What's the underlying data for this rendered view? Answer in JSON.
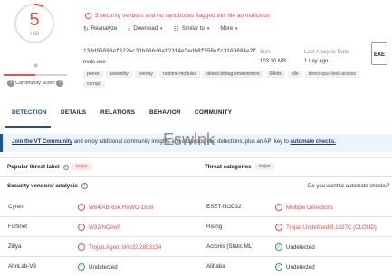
{
  "score": {
    "detections": "5",
    "total": "/ 68",
    "community_label": "Community Score",
    "community_icon": "question-icon"
  },
  "alert": {
    "text": "5 security vendors and no sandboxes flagged this file as malicious"
  },
  "actions": {
    "reanalyze": "Reanalyze",
    "download": "Download",
    "similar": "Similar to",
    "more": "More"
  },
  "file": {
    "hash": "138d95098ef622ac31b006d6af23f4efedb8f558efc3109884e2f...",
    "name": "node.exe",
    "size_label": "Size",
    "size_value": "103.30 MB",
    "last_label": "Last Analysis Date",
    "last_value": "1 day ago",
    "type": "EXE"
  },
  "tags": [
    "peexe",
    "assembly",
    "overlay",
    "runtime-modules",
    "detect-debug-environment",
    "64bits",
    "idle",
    "direct-cpu-clock-access",
    "corrupt"
  ],
  "tabs": [
    "DETECTION",
    "DETAILS",
    "RELATIONS",
    "BEHAVIOR",
    "COMMUNITY"
  ],
  "banner": {
    "link1": "Join the VT Community",
    "middle": "and enjoy additional community insights and crowdsourced detections, plus an API key to",
    "link2": "automate checks."
  },
  "watermark": "Eswlnk",
  "threat": {
    "popular_label": "Popular threat label",
    "popular_value": "trojan.",
    "categories_label": "Threat categories",
    "categories_value": "trojan"
  },
  "vendors_header": {
    "title": "Security vendors' analysis",
    "automate": "Do you want to automate checks?"
  },
  "vendors": [
    {
      "left": "Cyren",
      "left_result": "W64/ABRisk.HVWO-1808",
      "left_status": "bad",
      "right": "ESET-NOD32",
      "right_result": "Multiple Detections",
      "right_status": "bad"
    },
    {
      "left": "Fortinet",
      "left_result": "W32/NOAoF",
      "left_status": "bad",
      "right": "Rising",
      "right_result": "Trojan.Undefined!8.1327C (CLOUD)",
      "right_status": "bad"
    },
    {
      "left": "Zillya",
      "left_result": "Trojan.Agent.Win32.2853154",
      "left_status": "bad",
      "right": "Acronis (Static ML)",
      "right_result": "Undetected",
      "right_status": "ok"
    },
    {
      "left": "AhnLab-V3",
      "left_result": "Undetected",
      "left_status": "ok",
      "right": "Alibaba",
      "right_result": "Undetected",
      "right_status": "ok"
    }
  ],
  "colors": {
    "malicious": "#d9534f",
    "clean": "#3a9a5a",
    "accent": "#1a4fa3"
  }
}
